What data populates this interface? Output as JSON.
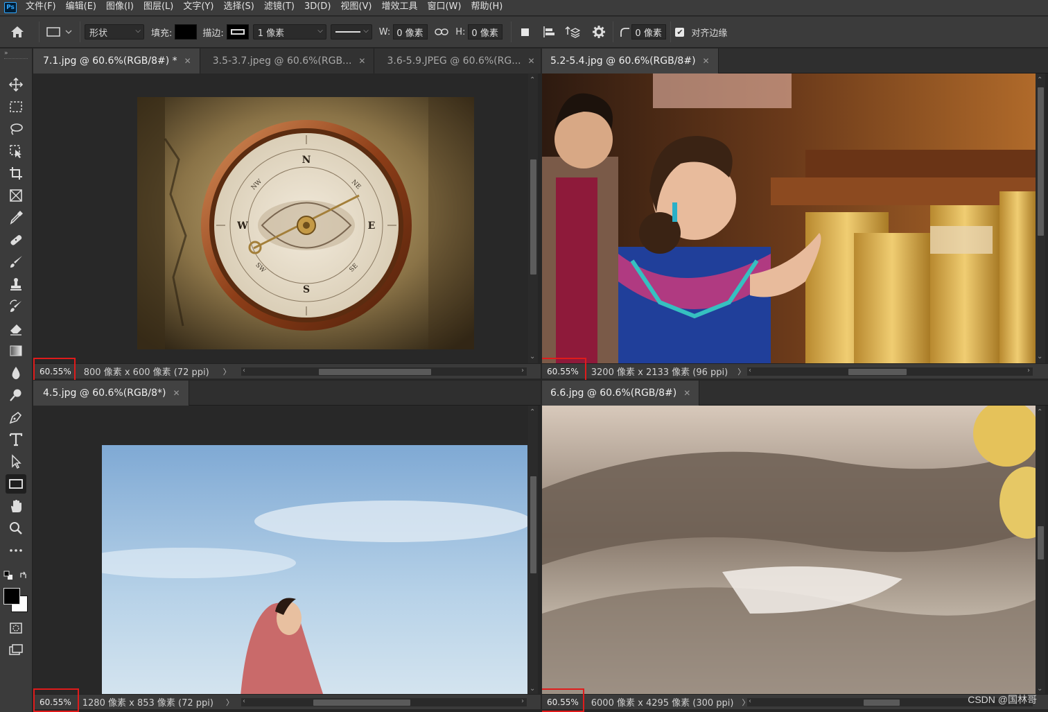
{
  "app": {
    "logo": "Ps"
  },
  "menu": [
    "文件(F)",
    "编辑(E)",
    "图像(I)",
    "图层(L)",
    "文字(Y)",
    "选择(S)",
    "滤镜(T)",
    "3D(D)",
    "视图(V)",
    "增效工具",
    "窗口(W)",
    "帮助(H)"
  ],
  "options": {
    "mode": "形状",
    "fill_label": "填充:",
    "stroke_label": "描边:",
    "stroke_width": "1 像素",
    "w_label": "W:",
    "w_value": "0 像素",
    "h_label": "H:",
    "h_value": "0 像素",
    "radius_value": "0 像素",
    "align_edges_label": "对齐边缘",
    "align_edges_checked": true
  },
  "panes": {
    "top_left": {
      "tabs": [
        {
          "label": "7.1.jpg @ 60.6%(RGB/8#) *",
          "active": true
        },
        {
          "label": "3.5-3.7.jpeg @ 60.6%(RGB...",
          "active": false
        },
        {
          "label": "3.6-5.9.JPEG @ 60.6%(RG...",
          "active": false
        }
      ],
      "zoom": "60.55%",
      "doc_info": "800 像素 x 600 像素 (72 ppi)",
      "compass": {
        "n": "N",
        "s": "S",
        "e": "E",
        "w": "W",
        "ne": "NE",
        "nw": "NW",
        "se": "SE",
        "sw": "SW"
      }
    },
    "top_right": {
      "tabs": [
        {
          "label": "5.2-5.4.jpg @ 60.6%(RGB/8#)",
          "active": true
        }
      ],
      "zoom": "60.55%",
      "doc_info": "3200 像素 x 2133 像素 (96 ppi)"
    },
    "bottom_left": {
      "tabs": [
        {
          "label": "4.5.jpg @ 60.6%(RGB/8*)",
          "active": true
        }
      ],
      "zoom": "60.55%",
      "doc_info": "1280 像素 x 853 像素 (72 ppi)"
    },
    "bottom_right": {
      "tabs": [
        {
          "label": "6.6.jpg @ 60.6%(RGB/8#)",
          "active": true
        }
      ],
      "zoom": "60.55%",
      "doc_info": "6000 像素 x 4295 像素 (300 ppi)"
    }
  },
  "watermark": "CSDN @国林哥",
  "colors": {
    "zoom_highlight": "#e01b1b",
    "accent": "#31a8ff"
  }
}
